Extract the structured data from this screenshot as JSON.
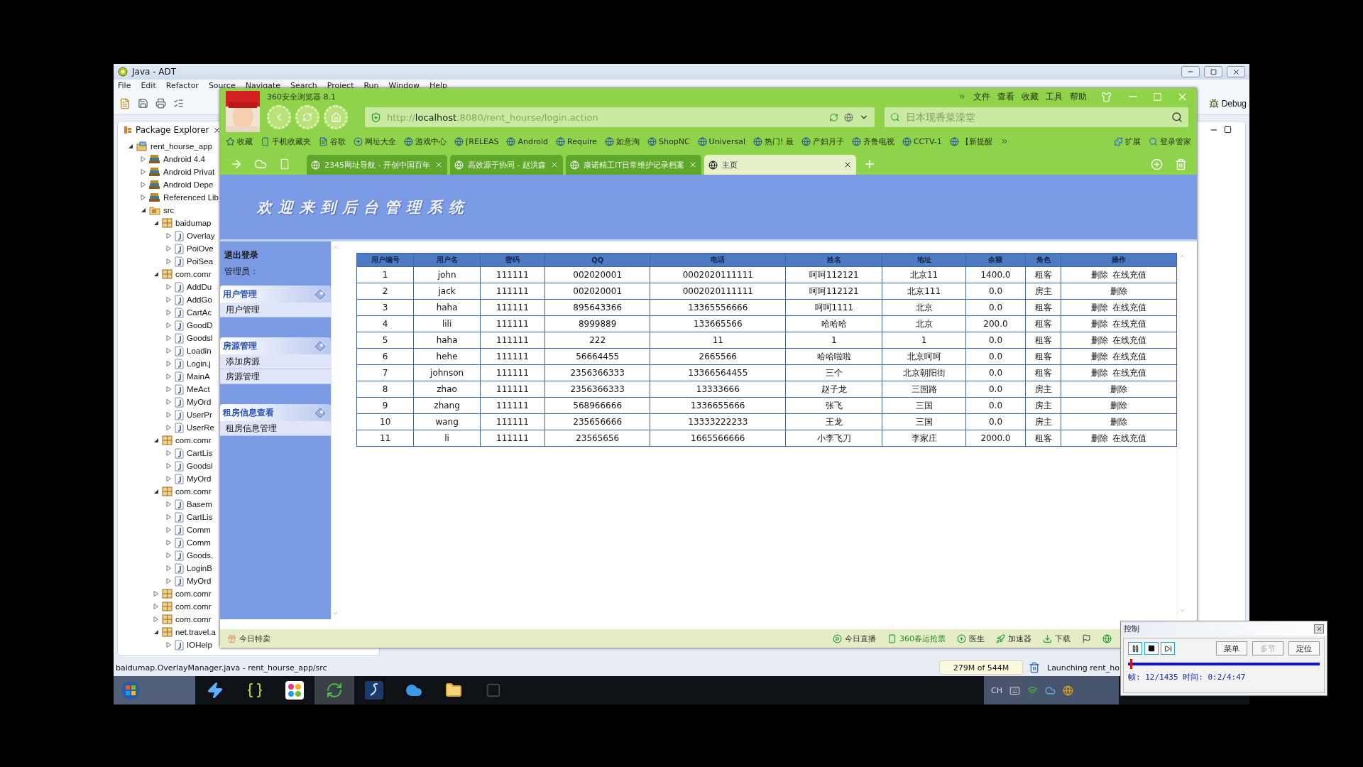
{
  "eclipse": {
    "title": "Java - ADT",
    "menu": [
      "File",
      "Edit",
      "Refactor",
      "Source",
      "Navigate",
      "Search",
      "Project",
      "Run",
      "Window",
      "Help"
    ],
    "perspective": "Debug",
    "package_explorer": {
      "title": "Package Explorer",
      "tree": [
        {
          "label": "rent_hourse_app",
          "kind": "project",
          "expanded": true,
          "children": [
            {
              "label": "Android 4.4",
              "kind": "library",
              "expanded": false
            },
            {
              "label": "Android Privat",
              "kind": "library",
              "expanded": false
            },
            {
              "label": "Android Depe",
              "kind": "library",
              "expanded": false
            },
            {
              "label": "Referenced Lib",
              "kind": "library",
              "expanded": false
            },
            {
              "label": "src",
              "kind": "folder",
              "expanded": true,
              "children": [
                {
                  "label": "baidumap",
                  "kind": "package",
                  "expanded": true,
                  "children": [
                    {
                      "label": "Overlay",
                      "kind": "file",
                      "expanded": false
                    },
                    {
                      "label": "PoiOve",
                      "kind": "file",
                      "expanded": false
                    },
                    {
                      "label": "PoiSea",
                      "kind": "file",
                      "expanded": false
                    }
                  ]
                },
                {
                  "label": "com.comr",
                  "kind": "package",
                  "expanded": true,
                  "children": [
                    {
                      "label": "AddDu",
                      "kind": "file",
                      "expanded": false
                    },
                    {
                      "label": "AddGo",
                      "kind": "file",
                      "expanded": false
                    },
                    {
                      "label": "CartAc",
                      "kind": "file",
                      "expanded": false
                    },
                    {
                      "label": "GoodD",
                      "kind": "file",
                      "expanded": false
                    },
                    {
                      "label": "Goodsl",
                      "kind": "file",
                      "expanded": false
                    },
                    {
                      "label": "Loadin",
                      "kind": "file",
                      "expanded": false
                    },
                    {
                      "label": "Login.j",
                      "kind": "file",
                      "expanded": false
                    },
                    {
                      "label": "MainA",
                      "kind": "file",
                      "expanded": false
                    },
                    {
                      "label": "MeAct",
                      "kind": "file",
                      "expanded": false
                    },
                    {
                      "label": "MyOrd",
                      "kind": "file",
                      "expanded": false
                    },
                    {
                      "label": "UserPr",
                      "kind": "file",
                      "expanded": false
                    },
                    {
                      "label": "UserRe",
                      "kind": "file",
                      "expanded": false
                    }
                  ]
                },
                {
                  "label": "com.comr",
                  "kind": "package",
                  "expanded": true,
                  "children": [
                    {
                      "label": "CartLis",
                      "kind": "file",
                      "expanded": false
                    },
                    {
                      "label": "Goodsl",
                      "kind": "file",
                      "expanded": false
                    },
                    {
                      "label": "MyOrd",
                      "kind": "file",
                      "expanded": false
                    }
                  ]
                },
                {
                  "label": "com.comr",
                  "kind": "package",
                  "expanded": true,
                  "children": [
                    {
                      "label": "Basem",
                      "kind": "file",
                      "expanded": false
                    },
                    {
                      "label": "CartLis",
                      "kind": "file",
                      "expanded": false
                    },
                    {
                      "label": "Comm",
                      "kind": "file",
                      "expanded": false
                    },
                    {
                      "label": "Comm",
                      "kind": "file",
                      "expanded": false
                    },
                    {
                      "label": "Goods.",
                      "kind": "file",
                      "expanded": false
                    },
                    {
                      "label": "LoginB",
                      "kind": "file",
                      "expanded": false
                    },
                    {
                      "label": "MyOrd",
                      "kind": "file",
                      "expanded": false
                    }
                  ]
                },
                {
                  "label": "com.comr",
                  "kind": "package",
                  "expanded": false
                },
                {
                  "label": "com.comr",
                  "kind": "package",
                  "expanded": false
                },
                {
                  "label": "com.comr",
                  "kind": "package",
                  "expanded": false
                },
                {
                  "label": "net.travel.a",
                  "kind": "package",
                  "expanded": true,
                  "children": [
                    {
                      "label": "IOHelp",
                      "kind": "file",
                      "expanded": false
                    }
                  ]
                }
              ]
            }
          ]
        }
      ]
    },
    "status": "baidumap.OverlayManager.java - rent_hourse_app/src",
    "memory": "279M of 544M",
    "progress": "Launching rent_ho"
  },
  "browser": {
    "title": "360安全浏览器 8.1",
    "menu": [
      "文件",
      "查看",
      "收藏",
      "工具",
      "帮助"
    ],
    "url": {
      "scheme": "http://",
      "host": "localhost",
      "path": ":8080/rent_hourse/login.action"
    },
    "search": {
      "placeholder": "日本现香菜澡堂"
    },
    "bookmarks": [
      "收藏",
      "手机收藏夹",
      "谷歌",
      "网址大全",
      "游戏中心",
      "[RELEAS",
      "Android",
      "Require",
      "如意淘",
      "ShopNC",
      "Universal",
      "热门! 最",
      "产妇月子",
      "齐鲁电视",
      "CCTV-1",
      "【新提醒"
    ],
    "extras": [
      "扩展",
      "登录管家"
    ],
    "tabs": [
      {
        "label": "2345网址导航 - 开创中国百年",
        "selected": false
      },
      {
        "label": "高效源于协同 - 赵洪森",
        "selected": false
      },
      {
        "label": "康诺精工IT日常维护记录档案",
        "selected": false
      },
      {
        "label": "主页",
        "selected": true
      }
    ],
    "page": {
      "banner": "欢迎来到后台管理系统",
      "logout": "退出登录",
      "admin": "管理员：",
      "groups": [
        {
          "title": "用户管理",
          "items": [
            "用户管理"
          ]
        },
        {
          "title": "房源管理",
          "items": [
            "添加房源",
            "房源管理"
          ]
        },
        {
          "title": "租房信息查看",
          "items": [
            "租房信息管理"
          ]
        }
      ],
      "table": {
        "columns": [
          "用户编号",
          "用户名",
          "密码",
          "QQ",
          "电话",
          "姓名",
          "地址",
          "余额",
          "角色",
          "操作"
        ],
        "rows": [
          {
            "cells": [
              "1",
              "john",
              "111111",
              "002020001",
              "0002020111111",
              "呵呵112121",
              "北京11",
              "1400.0",
              "租客"
            ],
            "actions": [
              "删除",
              "在线充值"
            ]
          },
          {
            "cells": [
              "2",
              "jack",
              "111111",
              "002020001",
              "0002020111111",
              "呵呵112121",
              "北京111",
              "0.0",
              "房主"
            ],
            "actions": [
              "删除"
            ]
          },
          {
            "cells": [
              "3",
              "haha",
              "111111",
              "895643366",
              "13365556666",
              "呵呵1111",
              "北京",
              "0.0",
              "租客"
            ],
            "actions": [
              "删除",
              "在线充值"
            ]
          },
          {
            "cells": [
              "4",
              "lili",
              "111111",
              "8999889",
              "133665566",
              "哈哈哈",
              "北京",
              "200.0",
              "租客"
            ],
            "actions": [
              "删除",
              "在线充值"
            ]
          },
          {
            "cells": [
              "5",
              "haha",
              "111111",
              "222",
              "11",
              "1",
              "1",
              "0.0",
              "租客"
            ],
            "actions": [
              "删除",
              "在线充值"
            ]
          },
          {
            "cells": [
              "6",
              "hehe",
              "111111",
              "56664455",
              "2665566",
              "哈哈啦啦",
              "北京呵呵",
              "0.0",
              "租客"
            ],
            "actions": [
              "删除",
              "在线充值"
            ]
          },
          {
            "cells": [
              "7",
              "johnson",
              "111111",
              "2356366333",
              "13366564455",
              "三个",
              "北京朝阳街",
              "0.0",
              "租客"
            ],
            "actions": [
              "删除",
              "在线充值"
            ]
          },
          {
            "cells": [
              "8",
              "zhao",
              "111111",
              "2356366333",
              "13333666",
              "赵子龙",
              "三国路",
              "0.0",
              "房主"
            ],
            "actions": [
              "删除"
            ]
          },
          {
            "cells": [
              "9",
              "zhang",
              "111111",
              "568966666",
              "1336655666",
              "张飞",
              "三国",
              "0.0",
              "房主"
            ],
            "actions": [
              "删除"
            ]
          },
          {
            "cells": [
              "10",
              "wang",
              "111111",
              "235656666",
              "13333222233",
              "王龙",
              "三国",
              "0.0",
              "房主"
            ],
            "actions": [
              "删除"
            ]
          },
          {
            "cells": [
              "11",
              "li",
              "111111",
              "23565656",
              "1665566666",
              "小李飞刀",
              "李家庄",
              "2000.0",
              "租客"
            ],
            "actions": [
              "删除",
              "在线充值"
            ]
          }
        ]
      }
    },
    "bottom_left": "今日特卖",
    "bottom_right": [
      "今日直播",
      "360春运抢票",
      "医生",
      "加速器",
      "下载"
    ]
  },
  "recorder": {
    "title": "控制",
    "buttons": [
      {
        "label": "菜单",
        "disabled": false
      },
      {
        "label": "多节",
        "disabled": true
      },
      {
        "label": "定位",
        "disabled": false
      }
    ],
    "level": 0.01,
    "info": "帧: 12/1435 时间: 0:2/4:47"
  },
  "taskbar": {
    "language": "CH"
  }
}
